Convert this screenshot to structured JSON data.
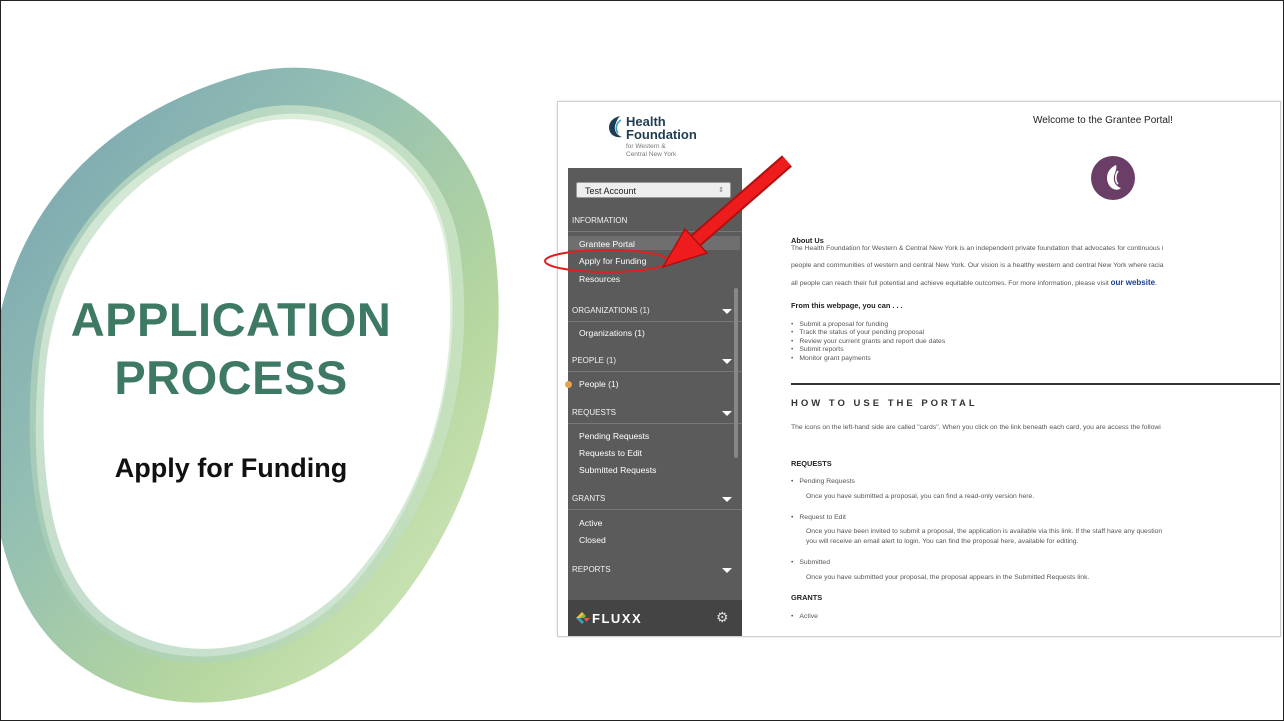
{
  "slide": {
    "title_line1": "APPLICATION",
    "title_line2": "PROCESS",
    "subtitle": "Apply for Funding"
  },
  "colors": {
    "title": "#3e7a63",
    "sidebar": "#5b5b5b",
    "highlight_ring": "#e02020",
    "arrow": "#e02020"
  },
  "portal": {
    "logo": {
      "line1": "Health",
      "line2": "Foundation",
      "sub1": "for Western &",
      "sub2": "Central New York"
    },
    "account_select": "Test Account",
    "sidebar": {
      "information": "INFORMATION",
      "grantee_portal": "Grantee Portal",
      "apply_for_funding": "Apply for Funding",
      "resources": "Resources",
      "organizations_header": "ORGANIZATIONS (1)",
      "organizations": "Organizations  (1)",
      "people_header": "PEOPLE (1)",
      "people": "People  (1)",
      "requests_header": "REQUESTS",
      "pending_requests": "Pending Requests",
      "requests_to_edit": "Requests to Edit",
      "submitted_requests": "Submitted Requests",
      "grants_header": "GRANTS",
      "active": "Active",
      "closed": "Closed",
      "reports_header": "REPORTS",
      "brand": "FLUXX"
    },
    "main": {
      "welcome": "Welcome to the Grantee Portal!",
      "about_heading": "About Us",
      "about_line1": "The Health Foundation for Western & Central New York is an independent private foundation that advocates for continuous i",
      "about_line2": "people and communities of western and central New York. Our vision is a healthy western and central New York where racia",
      "about_line3": "all people can reach their full potential and achieve equitable outcomes. For more information, please visit ",
      "about_link": "our website",
      "from_heading": "From this webpage, you can . . .",
      "can_items": [
        "Submit a proposal for funding",
        "Track the status of your pending proposal",
        "Review your current grants and report due dates",
        "Submit reports",
        "Monitor grant payments"
      ],
      "howto_heading": "HOW TO USE THE PORTAL",
      "howto_text": "The icons on the left-hand side are called \"cards\". When you click on the link beneath each card, you are access the followi",
      "requests_heading": "REQUESTS",
      "pending_label": "Pending Requests",
      "pending_desc": "Once you have submitted a proposal, you can find a read-only version here.",
      "edit_label": "Request to Edit",
      "edit_desc1": "Once you have been invited to submit a proposal, the application is available via this link. If the staff have any question",
      "edit_desc2": "you will receive an email alert to login. You can find the proposal here, available for editing.",
      "submitted_label": "Submitted",
      "submitted_desc": "Once you have submitted your proposal, the proposal appears in the Submitted Requests link.",
      "grants_heading": "GRANTS",
      "active_label": "Active"
    }
  }
}
